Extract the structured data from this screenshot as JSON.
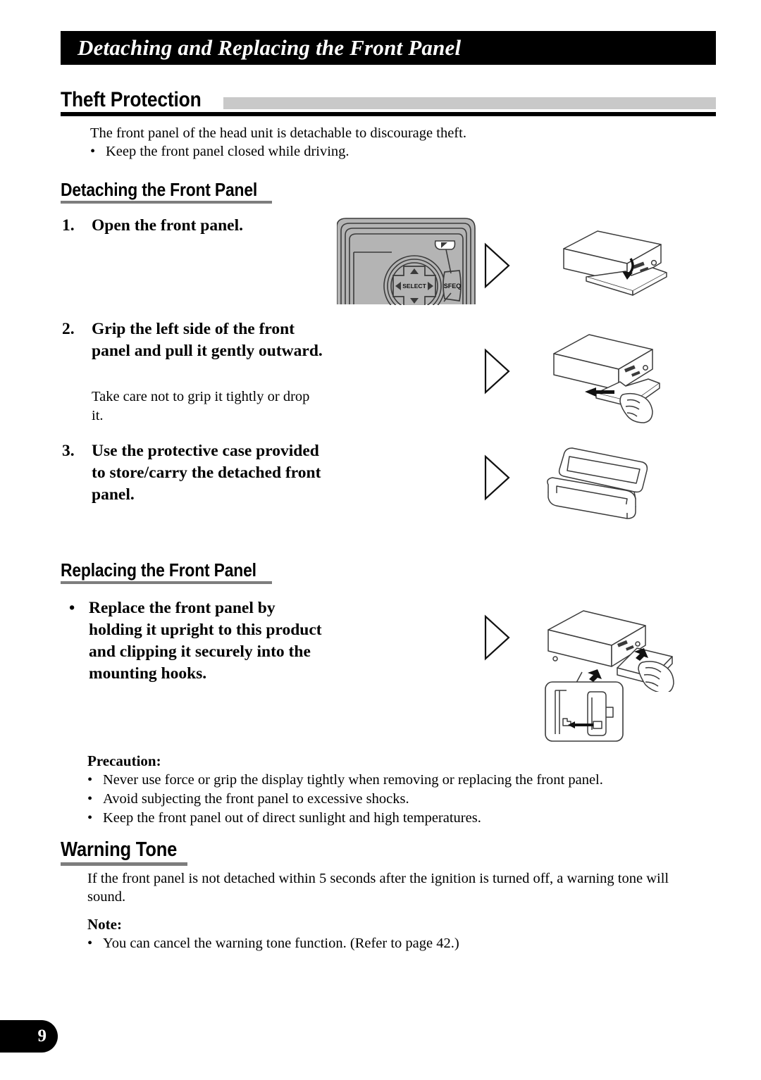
{
  "banner": {
    "title": "Detaching and Replacing the Front Panel"
  },
  "sections": {
    "theft_protection": {
      "heading": "Theft Protection",
      "intro": "The front panel of the head unit is detachable to discourage theft.",
      "bullets": [
        "Keep the front panel closed while driving."
      ]
    },
    "detaching": {
      "heading": "Detaching the Front Panel",
      "steps": [
        {
          "number": "1.",
          "text": "Open the front panel.",
          "note": ""
        },
        {
          "number": "2.",
          "text": "Grip the left side of the front panel and pull it gently outward.",
          "note": "Take care not to grip it tightly or drop it."
        },
        {
          "number": "3.",
          "text": "Use the protective case provided to store/carry the detached front panel.",
          "note": ""
        }
      ]
    },
    "replacing": {
      "heading": "Replacing the Front Panel",
      "bullet_marker": "•",
      "bullet": "Replace the front panel by holding it upright to this product and clipping it securely into the mounting hooks.",
      "precaution_label": "Precaution:",
      "precautions": [
        "Never use force or grip the display tightly when removing or replacing the front panel.",
        "Avoid subjecting the front panel to excessive shocks.",
        "Keep the front panel out of direct sunlight and high temperatures."
      ]
    },
    "warning_tone": {
      "heading": "Warning Tone",
      "body": "If the front panel is not detached within 5 seconds after the ignition is turned off, a warning tone will sound.",
      "note_label": "Note:",
      "notes": [
        "You can cancel the warning tone function. (Refer to page 42.)"
      ]
    }
  },
  "figures": {
    "faceplate": {
      "select_label": "SELECT",
      "sfeq_label": "SFEQ"
    }
  },
  "bullet_marker": "•",
  "footer": {
    "page_number": "9"
  },
  "colors": {
    "banner_bg": "#000000",
    "banner_text": "#ffffff",
    "heading_bar": "#c9c9c9",
    "heading_rule": "#000000",
    "subheading_rule": "#7d7d7d",
    "figure_line": "#3b3b3b",
    "figure_fill": "#b4b4b4"
  }
}
